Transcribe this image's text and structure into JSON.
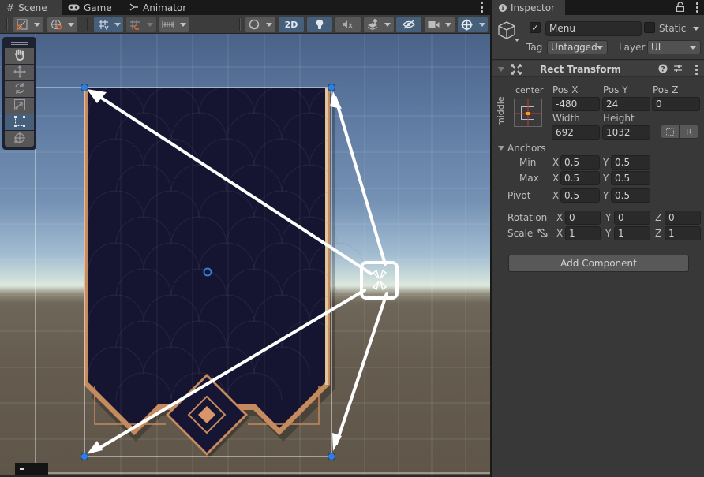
{
  "scene_panel": {
    "tabs": [
      {
        "label": "Scene",
        "icon": "grid-hash-icon",
        "active": true
      },
      {
        "label": "Game",
        "icon": "gamepad-icon",
        "active": false
      },
      {
        "label": "Animator",
        "icon": "animator-icon",
        "active": false
      }
    ],
    "toolbar": {
      "draw_mode": "shaded",
      "mode_2d_label": "2D",
      "toggles": {
        "grid_snap": true,
        "mode_2d": true,
        "lighting": true,
        "audio": false,
        "effects": false,
        "hidden_objects": true,
        "camera": false,
        "gizmos": true
      }
    },
    "tool_palette": {
      "tools": [
        {
          "name": "hand",
          "active": false
        },
        {
          "name": "move",
          "active": false
        },
        {
          "name": "rotate",
          "active": false
        },
        {
          "name": "scale",
          "active": false
        },
        {
          "name": "rect",
          "active": true
        },
        {
          "name": "transform",
          "active": false
        }
      ]
    },
    "colors": {
      "handle": "#2f7de1",
      "frame_gold": "#c58a5d",
      "panel_navy": "#151530",
      "annotation": "#ffffff"
    }
  },
  "inspector": {
    "tab_label": "Inspector",
    "game_object": {
      "active": true,
      "name": "Menu",
      "static_label": "Static",
      "static": false,
      "tag_label": "Tag",
      "tag_value": "Untagged",
      "layer_label": "Layer",
      "layer_value": "UI"
    },
    "rect_transform": {
      "title": "Rect Transform",
      "anchor_preset_h": "center",
      "anchor_preset_v": "middle",
      "pos_x_label": "Pos X",
      "pos_x": "-480",
      "pos_y_label": "Pos Y",
      "pos_y": "24",
      "pos_z_label": "Pos Z",
      "pos_z": "0",
      "width_label": "Width",
      "width": "692",
      "height_label": "Height",
      "height": "1032",
      "raw_edit_label": "R",
      "anchors_label": "Anchors",
      "min_label": "Min",
      "min_x": "0.5",
      "min_y": "0.5",
      "max_label": "Max",
      "max_x": "0.5",
      "max_y": "0.5",
      "pivot_label": "Pivot",
      "pivot_x": "0.5",
      "pivot_y": "0.5",
      "rotation_label": "Rotation",
      "rot_x": "0",
      "rot_y": "0",
      "rot_z": "0",
      "scale_label": "Scale",
      "scale_x": "1",
      "scale_y": "1",
      "scale_z": "1",
      "x_label": "X",
      "y_label": "Y",
      "z_label": "Z"
    },
    "add_component_label": "Add Component"
  }
}
